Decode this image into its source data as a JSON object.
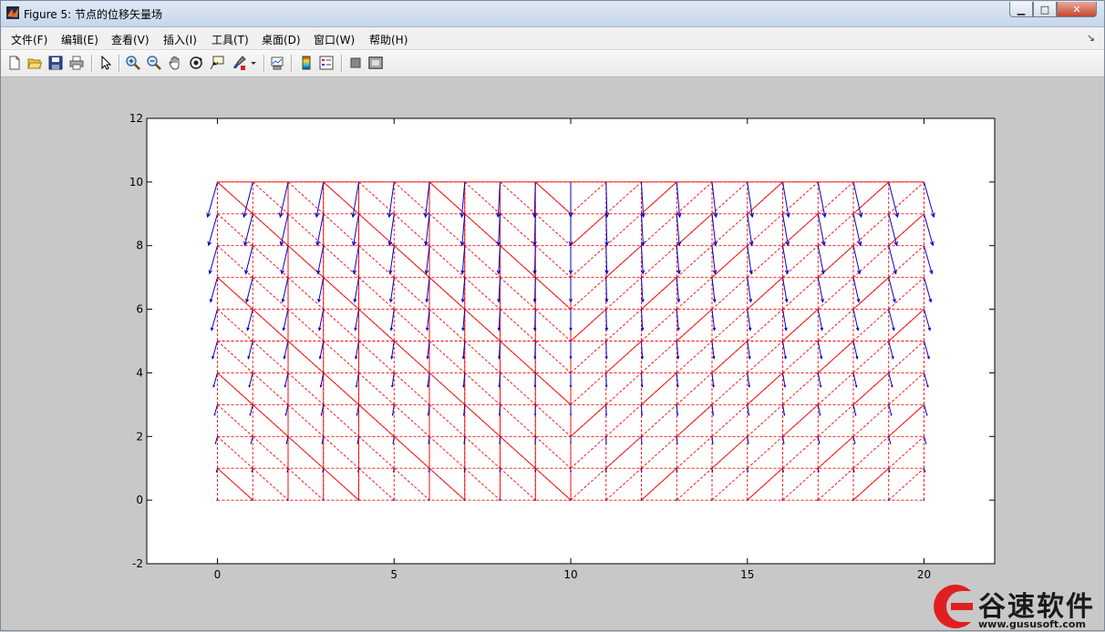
{
  "window": {
    "title": "Figure 5: 节点的位移矢量场",
    "minimize_symbol": "▁",
    "maximize_symbol": "□",
    "close_symbol": "✕"
  },
  "menu": {
    "items": [
      {
        "label": "文件(F)"
      },
      {
        "label": "编辑(E)"
      },
      {
        "label": "查看(V)"
      },
      {
        "label": "插入(I)"
      },
      {
        "label": "工具(T)"
      },
      {
        "label": "桌面(D)"
      },
      {
        "label": "窗口(W)"
      },
      {
        "label": "帮助(H)"
      }
    ],
    "overflow_symbol": "↘"
  },
  "toolbar": {
    "buttons": [
      {
        "icon": "new-figure-icon"
      },
      {
        "icon": "open-file-icon"
      },
      {
        "icon": "save-icon"
      },
      {
        "icon": "print-icon"
      },
      {
        "icon": "edit-plot-arrow-icon"
      },
      {
        "icon": "zoom-in-icon"
      },
      {
        "icon": "zoom-out-icon"
      },
      {
        "icon": "pan-hand-icon"
      },
      {
        "icon": "rotate-3d-icon"
      },
      {
        "icon": "data-cursor-icon"
      },
      {
        "icon": "brush-icon"
      },
      {
        "icon": "link-plot-icon"
      },
      {
        "icon": "colorbar-icon"
      },
      {
        "icon": "legend-icon"
      },
      {
        "icon": "hide-plot-tools-icon"
      },
      {
        "icon": "show-plot-tools-icon"
      }
    ]
  },
  "watermark": {
    "text": "谷速软件",
    "url": "www.gususoft.com"
  },
  "chart_data": {
    "type": "quiver",
    "title": "",
    "xlabel": "",
    "ylabel": "",
    "xlim": [
      -2,
      22
    ],
    "ylim": [
      -2,
      12
    ],
    "xticks": [
      0,
      5,
      10,
      15,
      20
    ],
    "yticks": [
      -2,
      0,
      2,
      4,
      6,
      8,
      10,
      12
    ],
    "grid": false,
    "mesh": {
      "x_nodes": [
        0,
        1,
        2,
        3,
        4,
        5,
        6,
        7,
        8,
        9,
        10,
        11,
        12,
        13,
        14,
        15,
        16,
        17,
        18,
        19,
        20
      ],
      "y_nodes": [
        0,
        1,
        2,
        3,
        4,
        5,
        6,
        7,
        8,
        9,
        10
      ],
      "original_mesh": {
        "color": "#ff0000",
        "style": "dashed"
      },
      "deformed_mesh": {
        "color": "#e00000",
        "style": "solid"
      }
    },
    "vector_field": {
      "color": "#0000cc",
      "description_nodes": "arrow at every mesh node, pointing downward, magnitude increasing with y"
    },
    "colors": {
      "axes_background": "#ffffff",
      "figure_background": "#c8c8c8",
      "arrows": "#0000cc",
      "mesh": "#ff0000"
    }
  }
}
